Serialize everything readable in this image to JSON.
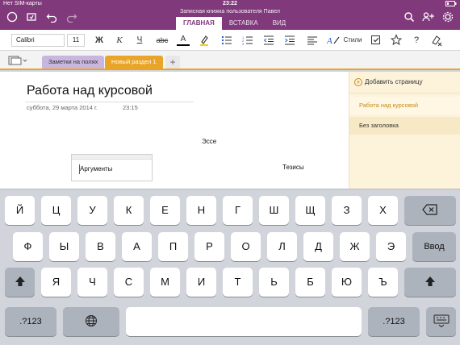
{
  "status_bar": {
    "carrier": "Нет SIM-карты",
    "time": "23:22"
  },
  "header": {
    "notebook_title": "Записная книжка пользователя Павел"
  },
  "ribbon_tabs": [
    {
      "label": "ГЛАВНАЯ",
      "active": true
    },
    {
      "label": "ВСТАВКА",
      "active": false
    },
    {
      "label": "ВИД",
      "active": false
    }
  ],
  "toolbar": {
    "font_name": "Calibri",
    "font_size": "11",
    "bold": "Ж",
    "italic": "К",
    "underline": "Ч",
    "strikethrough": "abc",
    "font_color": "A",
    "styles_label": "Стили"
  },
  "sections": [
    {
      "label": "Заметки на полях",
      "active": false
    },
    {
      "label": "Новый раздел 1",
      "active": true
    }
  ],
  "page": {
    "title": "Работа над курсовой",
    "date": "суббота, 29 марта 2014 г.",
    "time": "23:15",
    "text_essay": "Эссе",
    "text_arguments": "Аргументы",
    "text_thesis": "Тезисы"
  },
  "pages_pane": {
    "add_page": "Добавить страницу",
    "pages": [
      {
        "label": "Работа над курсовой",
        "active": true
      },
      {
        "label": "Без заголовка",
        "active": false
      }
    ]
  },
  "keyboard": {
    "row1": [
      "Й",
      "Ц",
      "У",
      "К",
      "Е",
      "Н",
      "Г",
      "Ш",
      "Щ",
      "З",
      "Х"
    ],
    "row2": [
      "Ф",
      "Ы",
      "В",
      "А",
      "П",
      "Р",
      "О",
      "Л",
      "Д",
      "Ж",
      "Э"
    ],
    "row3": [
      "Я",
      "Ч",
      "С",
      "М",
      "И",
      "Т",
      "Ь",
      "Б",
      "Ю",
      "Ъ"
    ],
    "enter": "Ввод",
    "numbers": ".?123"
  },
  "colors": {
    "brand": "#80397b",
    "section_accent": "#e8a528",
    "caret": "#2e5ed8"
  }
}
